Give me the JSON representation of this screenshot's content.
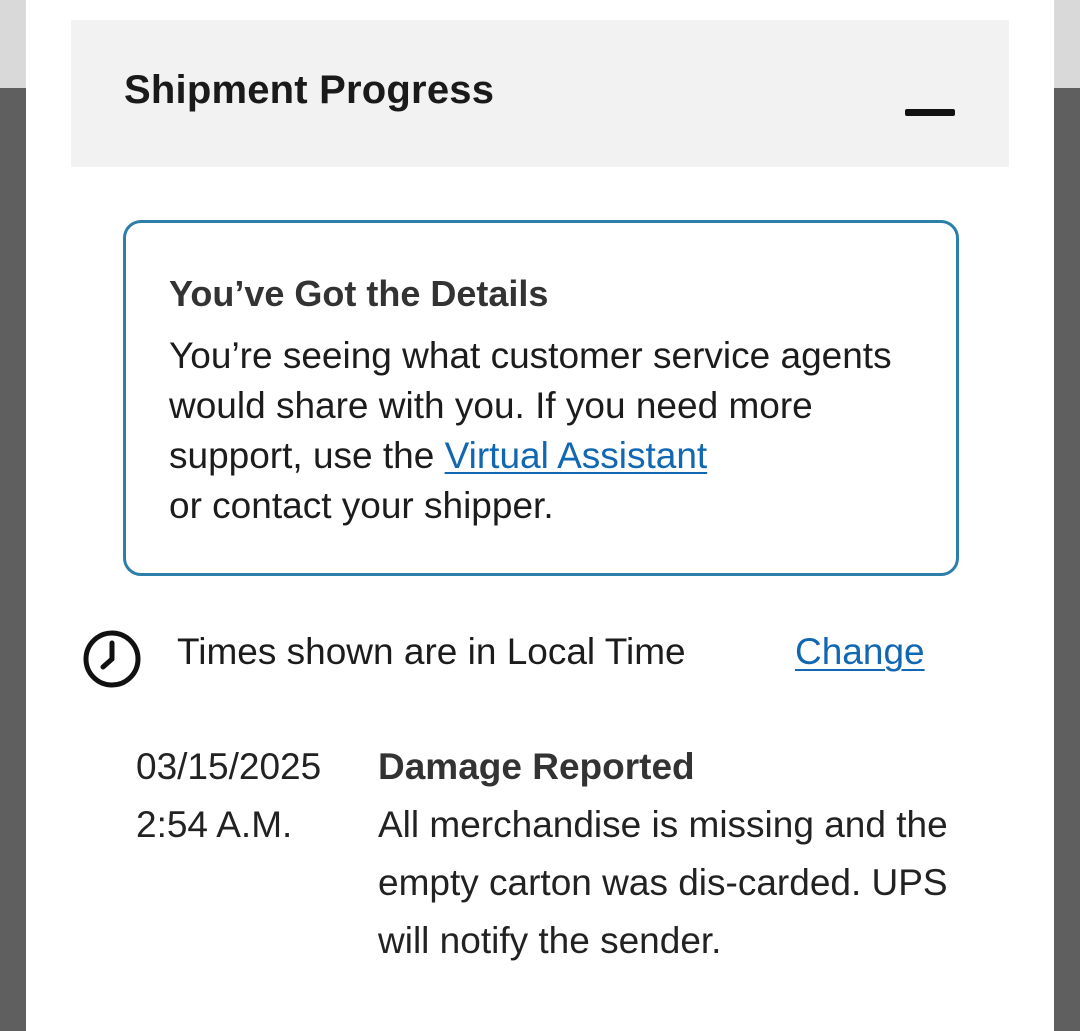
{
  "section": {
    "title": "Shipment Progress",
    "collapse_icon": "minus-icon"
  },
  "info_box": {
    "title": "You’ve Got the Details",
    "body_before_link": "You’re seeing what customer service agents would share with you. If you need more support, use the ",
    "link_label": "Virtual Assistant",
    "body_after_link": " or contact your shipper."
  },
  "time_zone": {
    "icon": "clock-icon",
    "label": "Times shown are in Local Time",
    "change_label": "Change"
  },
  "events": [
    {
      "date": "03/15/2025",
      "time": "2:54 A.M.",
      "status": "Damage Reported",
      "description": "All merchandise is missing and the empty carton was dis-carded. UPS will notify the sender."
    }
  ],
  "colors": {
    "accent_border": "#2b7fa8",
    "link": "#1167b1",
    "header_bg": "#f2f2f2"
  }
}
